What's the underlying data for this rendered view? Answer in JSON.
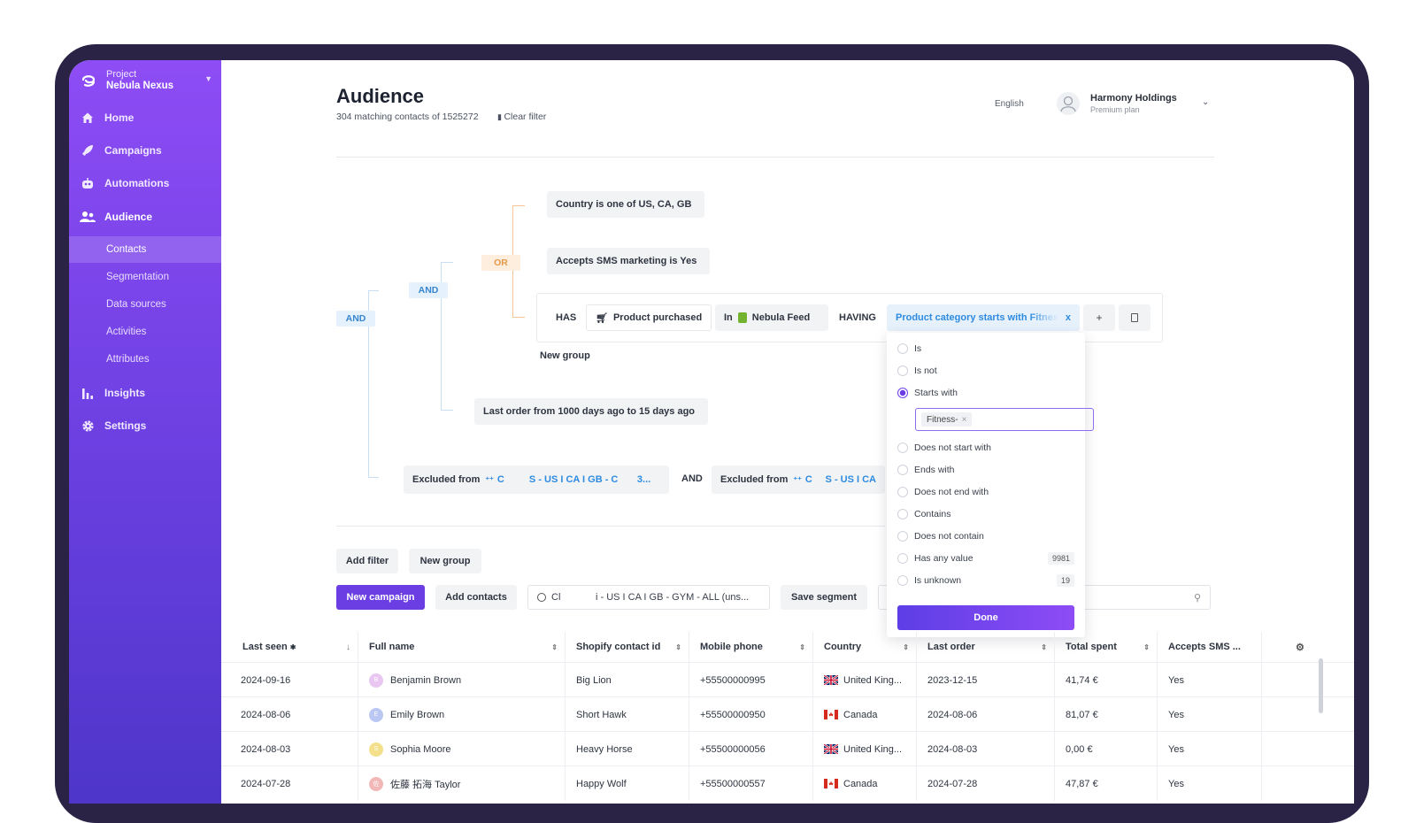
{
  "project": {
    "label": "Project",
    "name": "Nebula Nexus"
  },
  "nav": [
    {
      "label": "Home",
      "icon": "home-icon"
    },
    {
      "label": "Campaigns",
      "icon": "rocket-icon"
    },
    {
      "label": "Automations",
      "icon": "robot-icon"
    },
    {
      "label": "Audience",
      "icon": "people-icon"
    }
  ],
  "subnav": [
    "Contacts",
    "Segmentation",
    "Data sources",
    "Activities",
    "Attributes"
  ],
  "nav_bottom": [
    {
      "label": "Insights",
      "icon": "bar-chart-icon"
    },
    {
      "label": "Settings",
      "icon": "gear-icon"
    }
  ],
  "header": {
    "title": "Audience",
    "count": "304 matching contacts of 1525272",
    "clear_filter": "Clear filter",
    "language": "English",
    "user_name": "Harmony Holdings",
    "user_plan": "Premium plan"
  },
  "filters": {
    "and_outer": "AND",
    "and_inner": "AND",
    "or": "OR",
    "country": "Country is one of US, CA, GB",
    "sms": "Accepts SMS marketing is Yes",
    "has": "HAS",
    "product_purchased": "Product purchased",
    "in_label": "In",
    "feed": "Nebula Feed",
    "having": "HAVING",
    "category": "Product category starts with Fitness",
    "category_close": "x",
    "plus": "+",
    "new_group_inner": "New group",
    "last_order": "Last order from 1000 days ago to 15 days ago",
    "excluded_label": "Excluded from",
    "excluded_1a": "C",
    "excluded_1b": "S - US I CA I GB - C",
    "excluded_1c": "3...",
    "and_between": "AND",
    "excluded_2a": "C",
    "excluded_2b": "S - US I CA"
  },
  "dropdown": {
    "options": [
      {
        "label": "Is",
        "selected": false,
        "count": ""
      },
      {
        "label": "Is not",
        "selected": false,
        "count": ""
      },
      {
        "label": "Starts with",
        "selected": true,
        "count": ""
      }
    ],
    "token": "Fitness-",
    "token_close": "×",
    "options_after": [
      {
        "label": "Does not start with",
        "count": ""
      },
      {
        "label": "Ends with",
        "count": ""
      },
      {
        "label": "Does not end with",
        "count": ""
      },
      {
        "label": "Contains",
        "count": ""
      },
      {
        "label": "Does not contain",
        "count": ""
      },
      {
        "label": "Has any value",
        "count": "9981"
      },
      {
        "label": "Is unknown",
        "count": "19"
      }
    ],
    "done": "Done"
  },
  "actions": {
    "add_filter": "Add filter",
    "new_group": "New group",
    "new_campaign": "New campaign",
    "add_contacts": "Add contacts",
    "segment_a": "Cl",
    "segment_b": "i - US I CA I GB - GYM - ALL (uns...",
    "save_segment": "Save segment"
  },
  "table": {
    "columns": [
      "Last seen",
      "Full name",
      "Shopify contact id",
      "Mobile phone",
      "Country",
      "Last order",
      "Total spent",
      "Accepts SMS ..."
    ],
    "rows": [
      {
        "last_seen": "2024-09-16",
        "initial": "B",
        "name": "Benjamin Brown",
        "shopify": "Big Lion",
        "phone": "+55500000995",
        "country": "United King...",
        "flag": "uk",
        "last_order": "2023-12-15",
        "spent": "41,74 €",
        "sms": "Yes",
        "av_color": "#e9c7f2"
      },
      {
        "last_seen": "2024-08-06",
        "initial": "E",
        "name": "Emily Brown",
        "shopify": "Short Hawk",
        "phone": "+55500000950",
        "country": "Canada",
        "flag": "ca",
        "last_order": "2024-08-06",
        "spent": "81,07 €",
        "sms": "Yes",
        "av_color": "#b9c7f2"
      },
      {
        "last_seen": "2024-08-03",
        "initial": "S",
        "name": "Sophia Moore",
        "shopify": "Heavy Horse",
        "phone": "+55500000056",
        "country": "United King...",
        "flag": "uk",
        "last_order": "2024-08-03",
        "spent": "0,00 €",
        "sms": "Yes",
        "av_color": "#f4e08a"
      },
      {
        "last_seen": "2024-07-28",
        "initial": "佐",
        "name": "佐藤 拓海 Taylor",
        "shopify": "Happy Wolf",
        "phone": "+55500000557",
        "country": "Canada",
        "flag": "ca",
        "last_order": "2024-07-28",
        "spent": "47,87 €",
        "sms": "Yes",
        "av_color": "#f2b8b8"
      }
    ]
  }
}
